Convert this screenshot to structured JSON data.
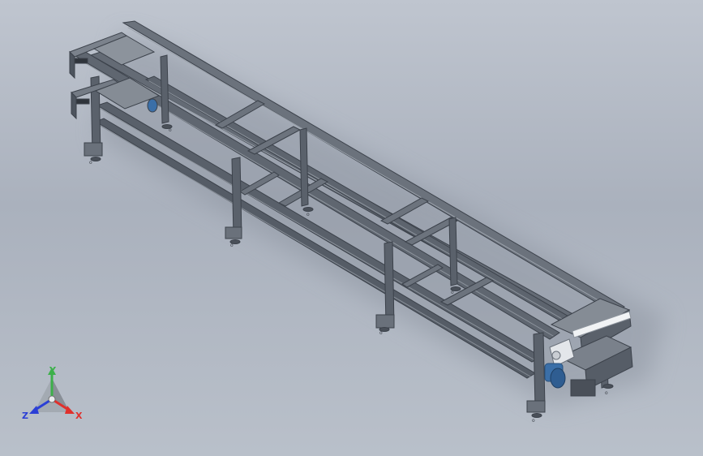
{
  "viewport": {
    "background_top": "#bfc5cf",
    "background_bottom": "#b9c0ca"
  },
  "model": {
    "frame_color": "#5f6670",
    "frame_highlight": "#8d949d",
    "frame_shadow": "#3c424b",
    "motor_color": "#3b6fa8",
    "motor_housing": "#e3e6ea"
  },
  "triad": {
    "x_label": "X",
    "y_label": "Y",
    "z_label": "Z",
    "x_color": "#e0302c",
    "y_color": "#3cb04a",
    "z_color": "#2b3fd6"
  }
}
